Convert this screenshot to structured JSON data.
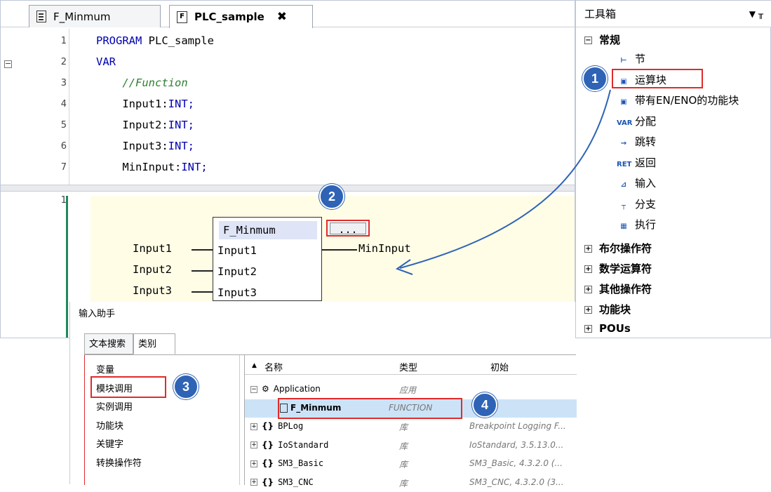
{
  "editor": {
    "tabs": [
      {
        "label": "F_Minmum"
      },
      {
        "label": "PLC_sample",
        "close": "✖"
      }
    ],
    "decl_lines": [
      {
        "n": "1",
        "parts": [
          {
            "t": "PROGRAM ",
            "c": "kw"
          },
          {
            "t": "PLC_sample",
            "c": ""
          }
        ]
      },
      {
        "n": "2",
        "parts": [
          {
            "t": "VAR",
            "c": "kw"
          }
        ]
      },
      {
        "n": "3",
        "parts": [
          {
            "t": "    //Function",
            "c": "cm"
          }
        ]
      },
      {
        "n": "4",
        "parts": [
          {
            "t": "    Input1:",
            "c": ""
          },
          {
            "t": "INT;",
            "c": "kw"
          }
        ]
      },
      {
        "n": "5",
        "parts": [
          {
            "t": "    Input2:",
            "c": ""
          },
          {
            "t": "INT;",
            "c": "kw"
          }
        ]
      },
      {
        "n": "6",
        "parts": [
          {
            "t": "    Input3:",
            "c": ""
          },
          {
            "t": "INT;",
            "c": "kw"
          }
        ]
      },
      {
        "n": "7",
        "parts": [
          {
            "t": "    MinInput:",
            "c": ""
          },
          {
            "t": "INT;",
            "c": "kw"
          }
        ]
      }
    ],
    "impl_line": "1",
    "fb_name": "F_Minmum",
    "fb_inputs": [
      "Input1",
      "Input2",
      "Input3"
    ],
    "fb_input_vars": [
      "Input1",
      "Input2",
      "Input3"
    ],
    "fb_output_var": "MinInput",
    "dots_label": "..."
  },
  "toolbox": {
    "title": "工具箱",
    "pin_controls": "▼ ╥",
    "general_group": "常规",
    "general_items": [
      {
        "icon": "section-icon",
        "glyph": "⊢",
        "label": "节"
      },
      {
        "icon": "box-icon",
        "glyph": "▣",
        "label": "运算块"
      },
      {
        "icon": "box-en-icon",
        "glyph": "▣",
        "label": "带有EN/ENO的功能块"
      },
      {
        "icon": "assign-icon",
        "glyph": "VAR",
        "label": "分配"
      },
      {
        "icon": "jump-icon",
        "glyph": "→",
        "label": "跳转"
      },
      {
        "icon": "return-icon",
        "glyph": "RET",
        "label": "返回"
      },
      {
        "icon": "input-icon",
        "glyph": "⊿",
        "label": "输入"
      },
      {
        "icon": "branch-icon",
        "glyph": "┬",
        "label": "分支"
      },
      {
        "icon": "execute-icon",
        "glyph": "▦",
        "label": "执行"
      }
    ],
    "collapsed_groups": [
      "布尔操作符",
      "数学运算符",
      "其他操作符",
      "功能块",
      "POUs"
    ]
  },
  "assistant": {
    "title": "输入助手",
    "tabs": [
      "文本搜索",
      "类别"
    ],
    "categories": [
      "变量",
      "模块调用",
      "实例调用",
      "功能块",
      "关键字",
      "转换操作符"
    ],
    "columns": {
      "name": "名称",
      "type": "类型",
      "init": "初始"
    },
    "rows": [
      {
        "name": "Application",
        "type": "应用",
        "init": ""
      },
      {
        "name": "F_Minmum",
        "type": "FUNCTION",
        "init": ""
      },
      {
        "name": "BPLog",
        "type": "库",
        "init": "Breakpoint Logging F..."
      },
      {
        "name": "IoStandard",
        "type": "库",
        "init": "IoStandard, 3.5.13.0..."
      },
      {
        "name": "SM3_Basic",
        "type": "库",
        "init": "SM3_Basic, 4.3.2.0 (..."
      },
      {
        "name": "SM3_CNC",
        "type": "库",
        "init": "SM3_CNC, 4.3.2.0 (3..."
      }
    ]
  },
  "badges": [
    "1",
    "2",
    "3",
    "4"
  ],
  "colors": {
    "highlight": "#e02b2b",
    "badge": "#2e63b6",
    "keyword": "#0000b0",
    "comment": "#2e7d32",
    "impl_bg": "#fffde6"
  }
}
